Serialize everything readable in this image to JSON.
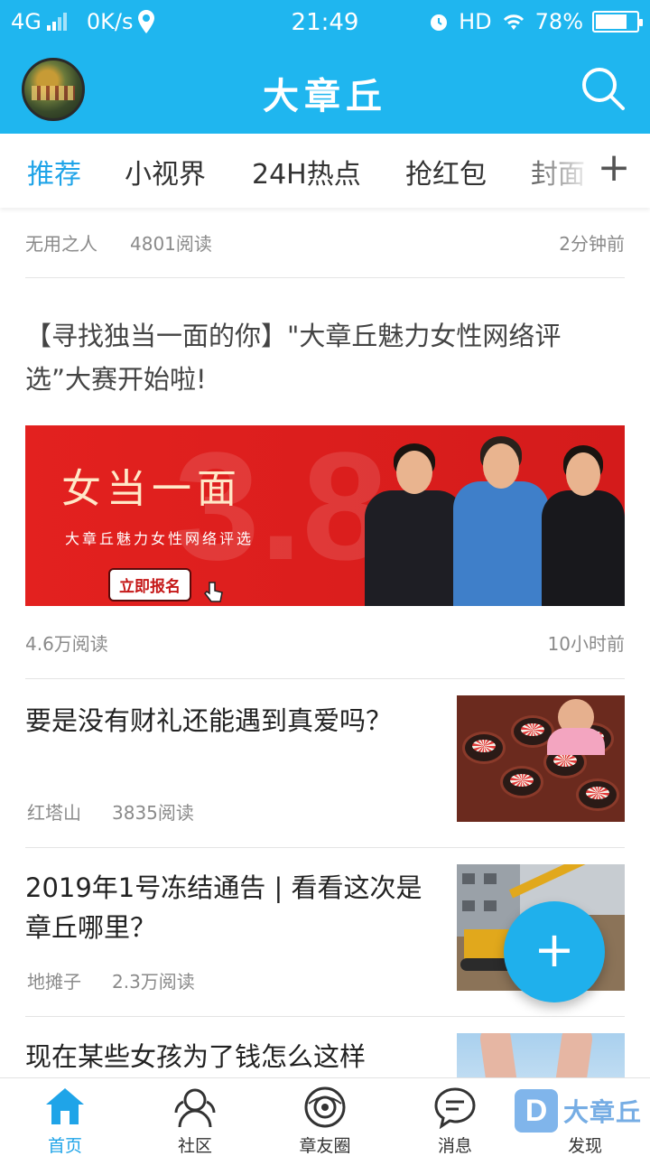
{
  "status_bar": {
    "network": "4G",
    "speed": "0K/s",
    "time": "21:49",
    "hd": "HD",
    "battery_percent": "78%",
    "battery_level": 0.78
  },
  "header": {
    "title": "大章丘"
  },
  "tabs": [
    {
      "label": "推荐",
      "active": true
    },
    {
      "label": "小视界"
    },
    {
      "label": "24H热点"
    },
    {
      "label": "抢红包"
    },
    {
      "label": "封面"
    }
  ],
  "tab_add_label": "+",
  "feed": {
    "top_partial": {
      "author": "无用之人",
      "reads": "4801阅读",
      "time": "2分钟前"
    },
    "banner_article": {
      "title": "【寻找独当一面的你】\"大章丘魅力女性网络评选”大赛开始啦!",
      "banner_big_text": "3.8",
      "banner_headline": "女当一面",
      "banner_subtitle": "大章丘魅力女性网络评选",
      "banner_button": "立即报名",
      "reads": "4.6万阅读",
      "time": "10小时前"
    },
    "articles": [
      {
        "title": "要是没有财礼还能遇到真爱吗？",
        "author": "红塔山",
        "reads": "3835阅读"
      },
      {
        "title": "2019年1号冻结通告 | 看看这次是章丘哪里？",
        "author": "地摊子",
        "reads": "2.3万阅读"
      },
      {
        "title": "现在某些女孩为了钱怎么这样"
      }
    ]
  },
  "fab_label": "+",
  "bottom_nav": [
    {
      "label": "首页",
      "icon": "home-icon",
      "active": true
    },
    {
      "label": "社区",
      "icon": "community-icon"
    },
    {
      "label": "章友圈",
      "icon": "circle-icon"
    },
    {
      "label": "消息",
      "icon": "message-icon"
    },
    {
      "label": "发现",
      "icon": "discover-icon"
    }
  ],
  "watermark": {
    "badge": "D",
    "text": "大章丘"
  },
  "colors": {
    "brand": "#1fb6ef",
    "active": "#1fa4e8",
    "banner_red": "#e3211f"
  }
}
